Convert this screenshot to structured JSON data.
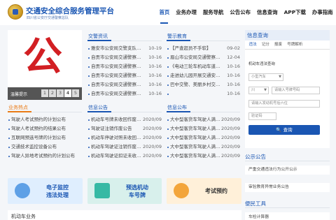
{
  "header": {
    "title": "交通安全综合服务管理平台",
    "subtitle": "四川省公安厅交通警察总队",
    "nav": [
      "首页",
      "业务办理",
      "服务导航",
      "公告公布",
      "信息查询",
      "APP下载",
      "办事指南"
    ]
  },
  "carousel": {
    "caption": "温馨提示",
    "pages": [
      "1",
      "2",
      "3",
      "4",
      "5"
    ],
    "active_page": "4"
  },
  "hot": {
    "title": "业务热点",
    "items": [
      "驾驶人考试预约的计划公布",
      "驾驶人考试预约的结果公布",
      "互联网预选号牌的计划公布",
      "交通技术监控设备公布",
      "驾驶人异地考试预约的计划公布"
    ]
  },
  "news1": {
    "title": "交警资讯",
    "items": [
      {
        "text": "雅安市公安局交警支队…",
        "date": "10-19"
      },
      {
        "text": "自贡市公安局交通警察…",
        "date": "10-16"
      },
      {
        "text": "自贡市公安局交通警察…",
        "date": "10-16"
      },
      {
        "text": "自贡市公安局交通警察…",
        "date": "10-16"
      },
      {
        "text": "自贡市公安局交通警察…",
        "date": "10-16"
      },
      {
        "text": "自贡市公安局交通警察…",
        "date": "10-16"
      }
    ]
  },
  "news2": {
    "title": "警示教育",
    "items": [
      {
        "text": "【严查超员不手软】",
        "date": "09-02"
      },
      {
        "text": "眉山市公安局交通警察…",
        "date": "12-04"
      },
      {
        "text": "《电动三轮车机动车道…",
        "date": "10-16"
      },
      {
        "text": "走进幼儿园开展交通安…",
        "date": "10-16"
      },
      {
        "text": "巴中交警、美丽乡村交…",
        "date": "10-16"
      },
      {
        "text": "",
        "date": "10-16"
      }
    ]
  },
  "news3": {
    "title": "信息公告",
    "items": [
      {
        "text": "机动车号牌未收回作废…",
        "date": "2020/09"
      },
      {
        "text": "驾驶证注销作废公告",
        "date": "2020/09"
      },
      {
        "text": "机动车停驶对照未收回…",
        "date": "2020/09"
      },
      {
        "text": "机动车驾驶证注销作废…",
        "date": "2020/09"
      },
      {
        "text": "机动车驾驶证扣证未收…",
        "date": "2020/09"
      }
    ]
  },
  "news4": {
    "title": "信息公布",
    "items": [
      {
        "text": "大中型客货车驾驶人满…",
        "date": "2020/09"
      },
      {
        "text": "大中型客货车驾驶人满…",
        "date": "2020/09"
      },
      {
        "text": "大中型客货车驾驶人满…",
        "date": "2020/09"
      },
      {
        "text": "大中型客货车驾驶人满…",
        "date": "2020/09"
      },
      {
        "text": "大中型客货车驾驶人满…",
        "date": "2020/09"
      }
    ]
  },
  "quick": {
    "q1": {
      "line1": "电子监控",
      "line2": "违法处理"
    },
    "q2": {
      "line1": "预选机动",
      "line2": "车号牌"
    },
    "q3": {
      "label": "考试预约"
    }
  },
  "bottom": {
    "title": "机动车业务"
  },
  "query": {
    "title": "信息查询",
    "tabs": [
      "违法",
      "记分",
      "报废",
      "号牌解析"
    ],
    "subtitle": "机动车违法查询",
    "vehicle_type": "小型汽车",
    "province": "川",
    "plate_placeholder": "请输入号牌号码",
    "vin_placeholder": "请输入发动机号后六位",
    "code_placeholder": "验证码",
    "button": "查询"
  },
  "notices": {
    "title": "公示公告",
    "items": [
      "严重交通违法行为公开公示",
      "审验教育异常业务公告"
    ]
  },
  "tools": {
    "title": "便民工具",
    "item": "车检计算器"
  },
  "colors": {
    "primary": "#1a56b3",
    "orange": "#ea7b16",
    "red": "#d21f23"
  }
}
